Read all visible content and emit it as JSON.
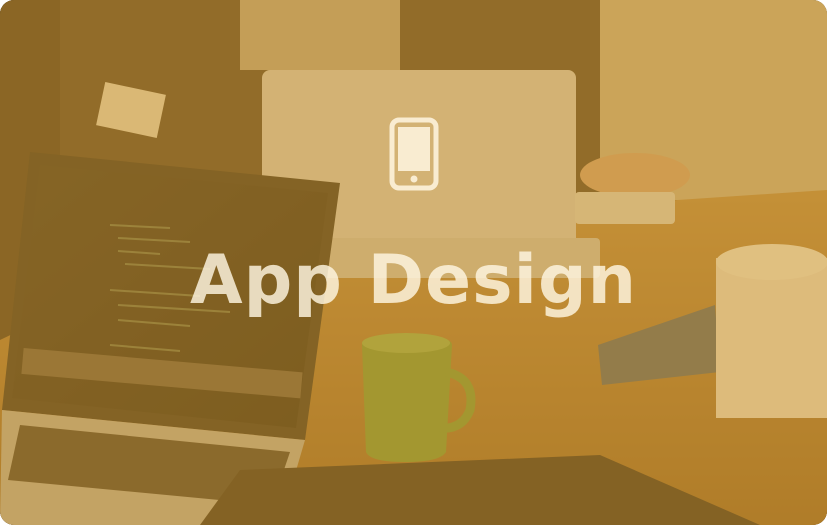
{
  "card": {
    "title": "App Design",
    "icon": "smartphone-icon",
    "overlay_color": "#cd9628",
    "title_color": "#fff6e2"
  }
}
